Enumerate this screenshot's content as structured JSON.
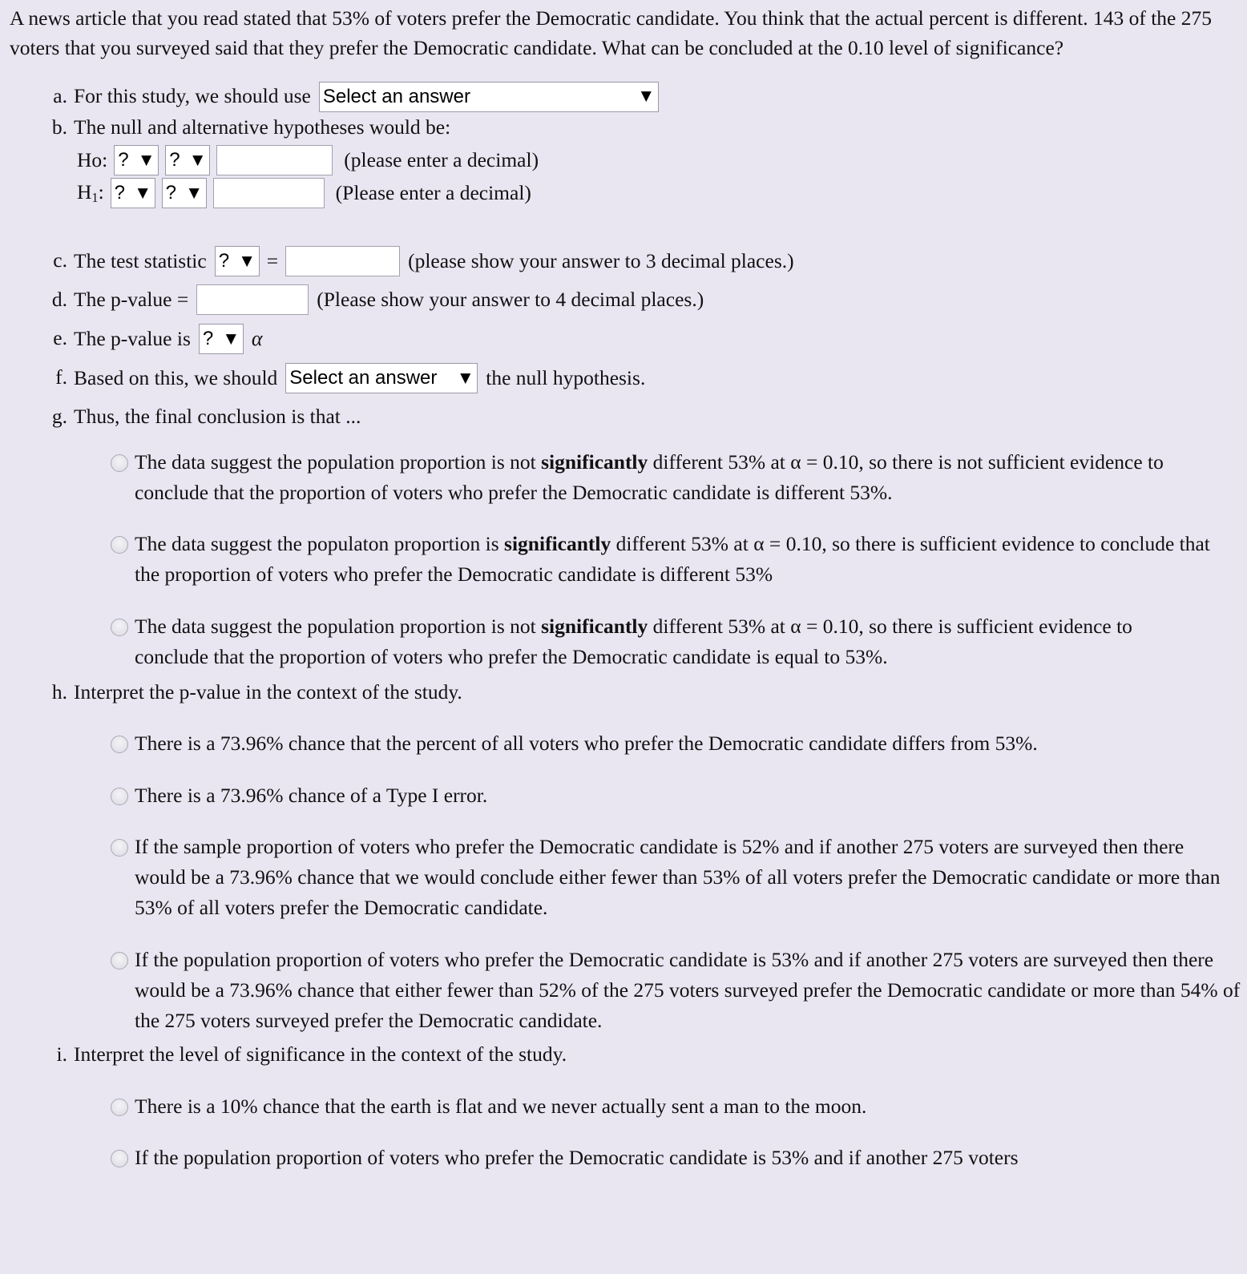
{
  "colors": {
    "page_background": "#e9e6f1",
    "input_background": "#ffffff",
    "input_border": "#9a9aa8",
    "radio_fill": "#e2e1e8",
    "text": "#111111"
  },
  "problem": {
    "statement": "A news article that you read stated that 53% of voters prefer the Democratic candidate. You think that the actual percent is different. 143 of the 275 voters that you surveyed said that they prefer the Democratic candidate. What can be concluded at the 0.10 level of significance?",
    "claimed_percent": "53%",
    "sample_successes": "143",
    "sample_size": "275",
    "alpha_level": "0.10",
    "p_value_reported": "73.96%"
  },
  "parts": {
    "a": {
      "letter": "a.",
      "text": "For this study, we should use",
      "select": {
        "value": "Select an answer",
        "options": [
          "Select an answer"
        ],
        "arrow": "chevron-down-icon"
      }
    },
    "b": {
      "letter": "b.",
      "text": "The null and alternative hypotheses would be:",
      "null_row": {
        "label": "Ho:",
        "param_select": {
          "value": "?",
          "options": [
            "?"
          ]
        },
        "operator_select": {
          "value": "?",
          "options": [
            "?"
          ]
        },
        "input_value": "",
        "input_placeholder": "",
        "note": "(please enter a decimal)"
      },
      "alt_row": {
        "label_main": "H",
        "label_sub": "1",
        "label_colon": ":",
        "param_select": {
          "value": "?",
          "options": [
            "?"
          ]
        },
        "operator_select": {
          "value": "?",
          "options": [
            "?"
          ]
        },
        "input_value": "",
        "input_placeholder": "",
        "note": "(Please enter a decimal)"
      }
    },
    "c": {
      "letter": "c.",
      "text_before": "The test statistic",
      "stat_select": {
        "value": "?",
        "options": [
          "?"
        ]
      },
      "equals": "=",
      "input_value": "",
      "note": "(please show your answer to 3 decimal places.)"
    },
    "d": {
      "letter": "d.",
      "text_before": "The p-value =",
      "input_value": "",
      "note": "(Please show your answer to 4 decimal places.)"
    },
    "e": {
      "letter": "e.",
      "text_before": "The p-value is",
      "compare_select": {
        "value": "?",
        "options": [
          "?"
        ]
      },
      "alpha_symbol": "α"
    },
    "f": {
      "letter": "f.",
      "text_before": "Based on this, we should",
      "select": {
        "value": "Select an answer",
        "options": [
          "Select an answer"
        ]
      },
      "text_after": "the null hypothesis."
    },
    "g": {
      "letter": "g.",
      "text": "Thus, the final conclusion is that ...",
      "options": [
        {
          "selected": false,
          "segments": [
            {
              "text": "The data suggest the population proportion is not ",
              "bold": false
            },
            {
              "text": "significantly",
              "bold": true
            },
            {
              "text": " different 53% at α = 0.10, so there is not sufficient evidence to conclude that the proportion of voters who prefer the Democratic candidate is different 53%.",
              "bold": false
            }
          ]
        },
        {
          "selected": false,
          "segments": [
            {
              "text": "The data suggest the populaton proportion is ",
              "bold": false
            },
            {
              "text": "significantly",
              "bold": true
            },
            {
              "text": " different 53% at α = 0.10, so there is sufficient evidence to conclude that the proportion of voters who prefer the Democratic candidate is different 53%",
              "bold": false
            }
          ]
        },
        {
          "selected": false,
          "segments": [
            {
              "text": "The data suggest the population proportion is not ",
              "bold": false
            },
            {
              "text": "significantly",
              "bold": true
            },
            {
              "text": " different 53% at α = 0.10, so there is sufficient evidence to conclude that the proportion of voters who prefer the Democratic candidate is equal to 53%.",
              "bold": false
            }
          ]
        }
      ]
    },
    "h": {
      "letter": "h.",
      "text": "Interpret the p-value in the context of the study.",
      "options": [
        {
          "selected": false,
          "text": "There is a 73.96% chance that the percent of all voters who prefer the Democratic candidate differs from 53%."
        },
        {
          "selected": false,
          "text": "There is a 73.96% chance of a Type I error."
        },
        {
          "selected": false,
          "text": "If the sample proportion of voters who prefer the Democratic candidate is 52% and if another 275 voters are surveyed then there would be a 73.96% chance that we would conclude either fewer than 53% of all voters prefer the Democratic candidate or more than 53% of all voters prefer the Democratic candidate."
        },
        {
          "selected": false,
          "text": "If the population proportion of voters who prefer the Democratic candidate is 53% and if another 275 voters are surveyed then there would be a 73.96% chance that either fewer than 52% of the 275 voters surveyed prefer the Democratic candidate or more than 54% of the 275 voters surveyed prefer the Democratic candidate."
        }
      ]
    },
    "i": {
      "letter": "i.",
      "text": "Interpret the level of significance in the context of the study.",
      "options": [
        {
          "selected": false,
          "text": "There is a 10% chance that the earth is flat and we never actually sent a man to the moon."
        },
        {
          "selected": false,
          "text": "If the population proportion of voters who prefer the Democratic candidate is 53% and if another 275 voters"
        }
      ]
    }
  }
}
